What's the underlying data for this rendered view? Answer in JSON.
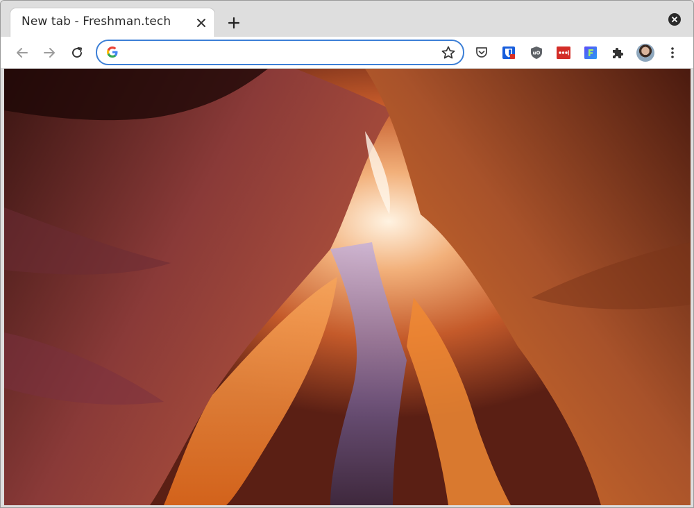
{
  "tab": {
    "title": "New tab - Freshman.tech"
  },
  "omnibox": {
    "value": "",
    "placeholder": ""
  },
  "toolbar": {
    "icons": [
      "back-arrow-icon",
      "forward-arrow-icon",
      "reload-icon",
      "google-g-icon",
      "bookmark-star-icon"
    ],
    "extensions": [
      "pocket-icon",
      "bitwarden-icon",
      "ublock-origin-icon",
      "lastpass-icon",
      "f-extension-icon",
      "puzzle-extensions-icon",
      "profile-avatar",
      "kebab-menu-icon"
    ]
  },
  "colors": {
    "omnibox_focus": "#3c7fd6",
    "tab_strip": "#dedede",
    "canyon_orange": "#e07a2c",
    "canyon_dark": "#2a0d08"
  }
}
